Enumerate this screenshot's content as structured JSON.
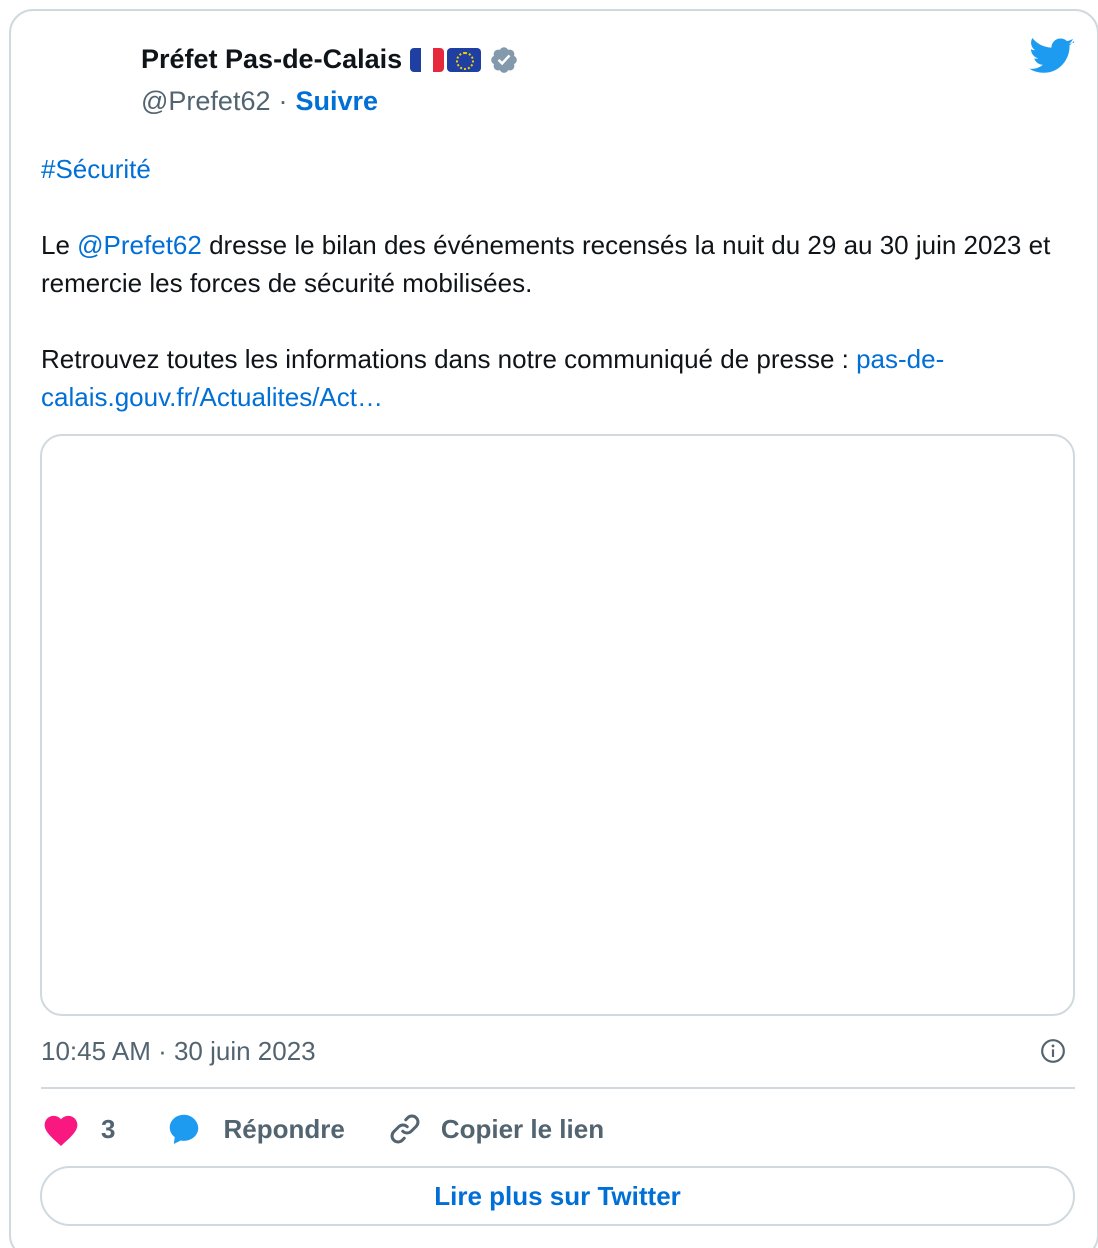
{
  "author": {
    "name": "Préfet Pas-de-Calais",
    "handle": "@Prefet62",
    "separator": "·",
    "follow_label": "Suivre"
  },
  "tweet": {
    "hashtag": "#Sécurité",
    "line1_prefix": "Le ",
    "mention": "@Prefet62",
    "line1_suffix": " dresse le bilan des événements recensés la nuit du 29 au 30 juin 2023 et remercie les forces de sécurité mobilisées.",
    "line2_prefix": "Retrouvez toutes les informations dans notre communiqué de presse : ",
    "link": "pas-de-calais.gouv.fr/Actualites/Act…"
  },
  "meta": {
    "timestamp": "10:45 AM · 30 juin 2023"
  },
  "actions": {
    "like_count": "3",
    "reply_label": "Répondre",
    "copy_label": "Copier le lien"
  },
  "footer": {
    "read_more_label": "Lire plus sur Twitter"
  },
  "icons": {
    "flags": [
      "flag-france-icon",
      "flag-eu-icon"
    ],
    "verified": "verified-badge-icon",
    "logo": "twitter-bird-icon",
    "info": "info-icon",
    "like": "heart-icon",
    "reply": "speech-bubble-icon",
    "copy": "link-icon"
  },
  "colors": {
    "link": "#006fd6",
    "heart": "#f91880",
    "reply_bubble": "#1d9bf0",
    "twitter_blue": "#1d9bf0",
    "muted": "#536471",
    "border": "#cfd9de"
  }
}
